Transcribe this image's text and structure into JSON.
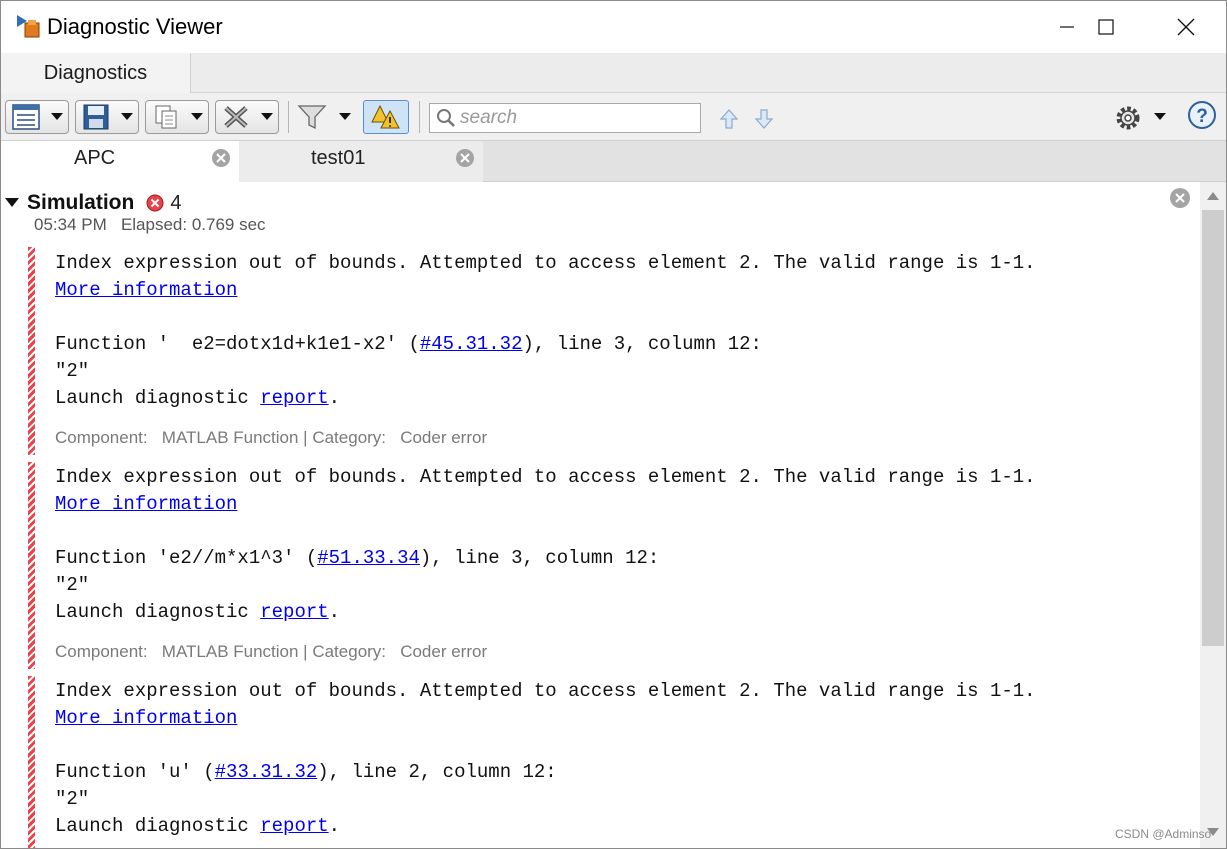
{
  "window": {
    "title": "Diagnostic Viewer"
  },
  "ribbon": {
    "tab_label": "Diagnostics"
  },
  "toolbar": {
    "search_placeholder": "search"
  },
  "doc_tabs": [
    {
      "label": "APC"
    },
    {
      "label": "test01"
    }
  ],
  "simulation": {
    "title": "Simulation",
    "error_count": "4",
    "time": "05:34 PM",
    "elapsed": "Elapsed: 0.769 sec"
  },
  "diagnostics": [
    {
      "message": "Index expression out of bounds. Attempted to access element 2. The valid range is 1-1.",
      "more_info": "More information",
      "func_prefix": "Function '  e2=dotx1d+k1e1-x2' (",
      "func_link": "#45.31.32",
      "func_suffix": "), line 3, column 12:",
      "value": "\"2\"",
      "launch_prefix": "Launch diagnostic ",
      "launch_link": "report",
      "launch_suffix": ".",
      "component": "Component:   MATLAB Function | Category:   Coder error"
    },
    {
      "message": "Index expression out of bounds. Attempted to access element 2. The valid range is 1-1.",
      "more_info": "More information",
      "func_prefix": "Function 'e2//m*x1^3' (",
      "func_link": "#51.33.34",
      "func_suffix": "), line 3, column 12:",
      "value": "\"2\"",
      "launch_prefix": "Launch diagnostic ",
      "launch_link": "report",
      "launch_suffix": ".",
      "component": "Component:   MATLAB Function | Category:   Coder error"
    },
    {
      "message": "Index expression out of bounds. Attempted to access element 2. The valid range is 1-1.",
      "more_info": "More information",
      "func_prefix": "Function 'u' (",
      "func_link": "#33.31.32",
      "func_suffix": "), line 2, column 12:",
      "value": "\"2\"",
      "launch_prefix": "Launch diagnostic ",
      "launch_link": "report",
      "launch_suffix": "."
    }
  ],
  "watermark": "CSDN @Adminso",
  "colors": {
    "error_red": "#e8424a",
    "link_blue": "#0000ee",
    "toggle_blue": "#cfe3f7"
  },
  "icons": [
    "app-icon",
    "minimize-icon",
    "maximize-icon",
    "close-icon",
    "list-view-icon",
    "save-icon",
    "copy-icon",
    "clear-icon",
    "filter-icon",
    "warning-toggle-icon",
    "search-icon",
    "arrow-up-icon",
    "arrow-down-icon",
    "gear-icon",
    "help-icon",
    "tab-close-icon",
    "error-icon",
    "collapse-triangle-icon"
  ]
}
